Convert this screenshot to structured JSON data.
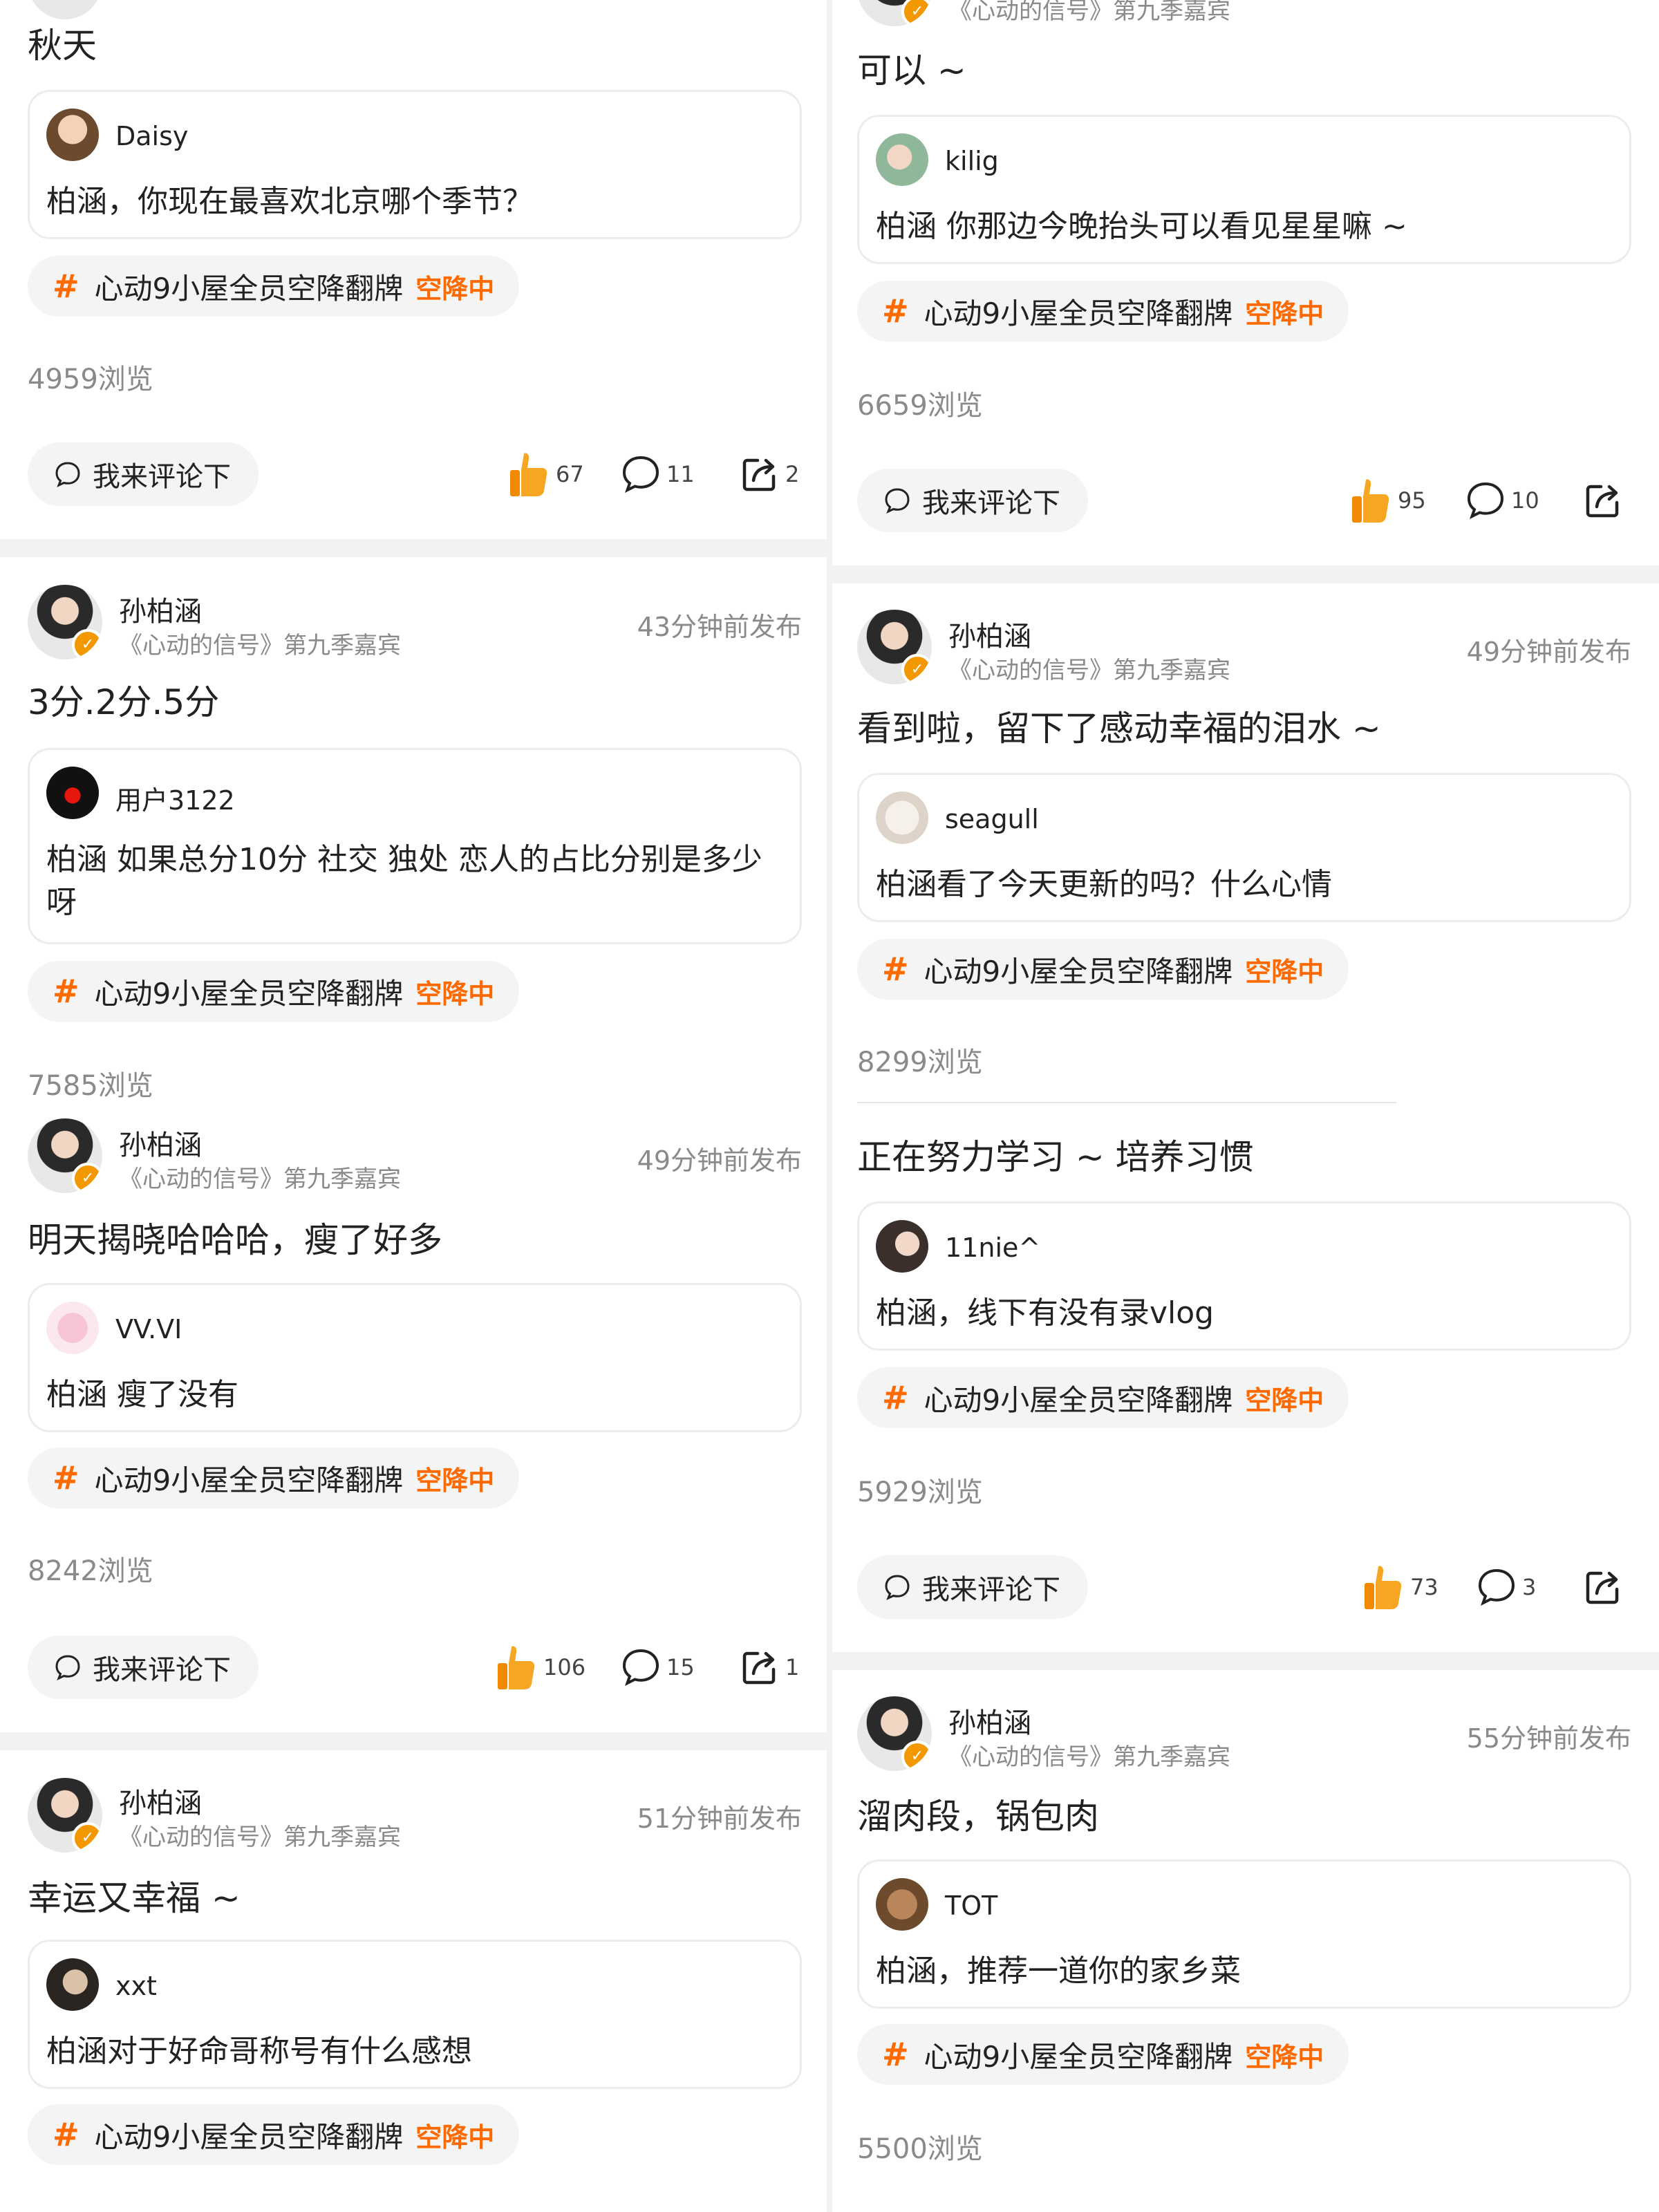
{
  "common": {
    "author_name": "孙柏涵",
    "author_sub": "《心动的信号》第九季嘉宾",
    "verified_mark": "✓",
    "topic_hash": "#",
    "topic_text": "心动9小屋全员空降翻牌",
    "topic_badge": "空降中",
    "comment_button": "我来评论下",
    "views_suffix": "浏览",
    "icons": [
      "chat-bubble-icon",
      "thumbs-up-icon",
      "comment-icon",
      "share-icon",
      "verified-icon"
    ],
    "accent_color": "#ff6a00",
    "verified_color": "#f39800"
  },
  "left": {
    "post1": {
      "text": "秋天",
      "question_user": "Daisy",
      "question_text": "柏涵，你现在最喜欢北京哪个季节？",
      "views": "4959浏览",
      "likes": "67",
      "comments": "11",
      "shares": "2"
    },
    "post2": {
      "time": "43分钟前发布",
      "text": "3分.2分.5分",
      "question_user": "用户3122",
      "question_text": "柏涵 如果总分10分 社交 独处 恋人的占比分别是多少呀",
      "views": "7585浏览"
    },
    "post3": {
      "time": "49分钟前发布",
      "text": "明天揭晓哈哈哈，瘦了好多",
      "question_user": "VV.VI",
      "question_text": "柏涵 瘦了没有",
      "views": "8242浏览",
      "likes": "106",
      "comments": "15",
      "shares": "1"
    },
    "post4": {
      "time": "51分钟前发布",
      "text": "幸运又幸福 ~",
      "question_user": "xxt",
      "question_text": "柏涵对于好命哥称号有什么感想"
    }
  },
  "right": {
    "post1": {
      "text": "可以 ~",
      "question_user": "kilig",
      "question_text": "柏涵 你那边今晚抬头可以看见星星嘛 ~",
      "views": "6659浏览",
      "likes": "95",
      "comments": "10"
    },
    "post2": {
      "time": "49分钟前发布",
      "text": "看到啦，留下了感动幸福的泪水 ~",
      "question_user": "seagull",
      "question_text": "柏涵看了今天更新的吗？什么心情",
      "views": "8299浏览"
    },
    "post3": {
      "text": "正在努力学习 ~ 培养习惯",
      "question_user": "11nie^",
      "question_text": "柏涵，线下有没有录vlog",
      "views": "5929浏览",
      "likes": "73",
      "comments": "3"
    },
    "post4": {
      "time": "55分钟前发布",
      "text": "溜肉段，锅包肉",
      "question_user": "TOT",
      "question_text": "柏涵，推荐一道你的家乡菜",
      "views": "5500浏览"
    }
  }
}
